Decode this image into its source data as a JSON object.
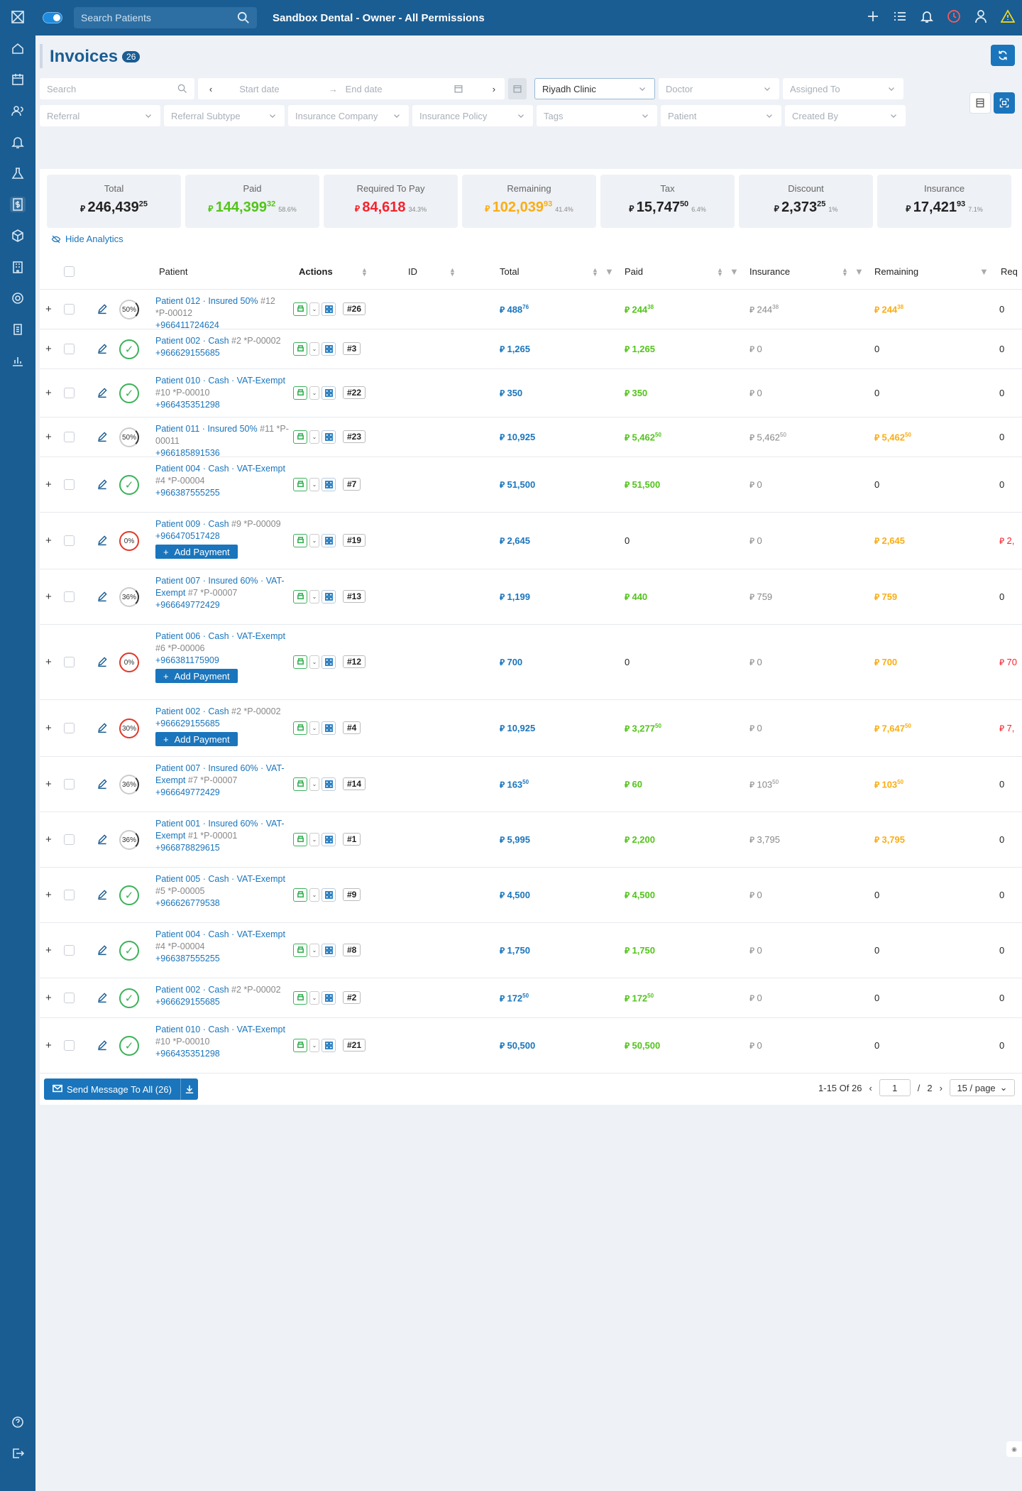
{
  "app": {
    "search_placeholder": "Search Patients",
    "title": "Sandbox Dental - Owner - All Permissions"
  },
  "page": {
    "title": "Invoices",
    "count": "26"
  },
  "filters": {
    "search": "Search",
    "start_date": "Start date",
    "end_date": "End date",
    "clinic": "Riyadh Clinic",
    "doctor": "Doctor",
    "assigned": "Assigned To",
    "referral": "Referral",
    "referral_sub": "Referral Subtype",
    "ins_company": "Insurance Company",
    "ins_policy": "Insurance Policy",
    "tags": "Tags",
    "patient": "Patient",
    "created_by": "Created By"
  },
  "stats": [
    {
      "label": "Total",
      "int": "246,439",
      "dec": "25",
      "pct": "",
      "color": "#222"
    },
    {
      "label": "Paid",
      "int": "144,399",
      "dec": "32",
      "pct": "58.6%",
      "color": "#52c41a"
    },
    {
      "label": "Required To Pay",
      "int": "84,618",
      "dec": "",
      "pct": "34.3%",
      "color": "#f5222d"
    },
    {
      "label": "Remaining",
      "int": "102,039",
      "dec": "93",
      "pct": "41.4%",
      "color": "#faad14"
    },
    {
      "label": "Tax",
      "int": "15,747",
      "dec": "50",
      "pct": "6.4%",
      "color": "#222"
    },
    {
      "label": "Discount",
      "int": "2,373",
      "dec": "25",
      "pct": "1%",
      "color": "#222"
    },
    {
      "label": "Insurance",
      "int": "17,421",
      "dec": "93",
      "pct": "7.1%",
      "color": "#222"
    }
  ],
  "currency": "⃁",
  "hide_analytics": "Hide Analytics",
  "columns": {
    "patient": "Patient",
    "actions": "Actions",
    "id": "ID",
    "total": "Total",
    "paid": "Paid",
    "insurance": "Insurance",
    "remaining": "Remaining",
    "req": "Req"
  },
  "add_payment": "Add Payment",
  "rows": [
    {
      "name": "Patient 012 · Insured 50%",
      "meta": "#12 *P-00012",
      "phone": "+966411724624",
      "pct": "50%",
      "status": "part",
      "id": "#26",
      "total": "488",
      "total_d": "76",
      "paid": "244",
      "paid_d": "38",
      "ins": "244",
      "ins_d": "38",
      "rem": "244",
      "rem_d": "38",
      "req": "0",
      "add": false
    },
    {
      "name": "Patient 002 · Cash",
      "meta": "#2 *P-00002",
      "phone": "+966629155685",
      "pct": "",
      "status": "full",
      "id": "#3",
      "total": "1,265",
      "total_d": "",
      "paid": "1,265",
      "paid_d": "",
      "ins": "0",
      "ins_d": "",
      "rem": "0",
      "rem_d": "",
      "req": "0",
      "add": false
    },
    {
      "name": "Patient 010 · Cash · VAT-Exempt",
      "meta": "#10 *P-00010",
      "phone": "+966435351298",
      "pct": "",
      "status": "full",
      "id": "#22",
      "total": "350",
      "total_d": "",
      "paid": "350",
      "paid_d": "",
      "ins": "0",
      "ins_d": "",
      "rem": "0",
      "rem_d": "",
      "req": "0",
      "add": false
    },
    {
      "name": "Patient 011 · Insured 50%",
      "meta": "#11 *P-00011",
      "phone": "+966185891536",
      "pct": "50%",
      "status": "part",
      "id": "#23",
      "total": "10,925",
      "total_d": "",
      "paid": "5,462",
      "paid_d": "50",
      "ins": "5,462",
      "ins_d": "50",
      "rem": "5,462",
      "rem_d": "50",
      "req": "0",
      "add": false
    },
    {
      "name": "Patient 004 · Cash · VAT-Exempt",
      "meta": "#4 *P-00004",
      "phone": "+966387555255",
      "pct": "",
      "status": "full",
      "id": "#7",
      "total": "51,500",
      "total_d": "",
      "paid": "51,500",
      "paid_d": "",
      "ins": "0",
      "ins_d": "",
      "rem": "0",
      "rem_d": "",
      "req": "0",
      "add": false
    },
    {
      "name": "Patient 009 · Cash",
      "meta": "#9 *P-00009",
      "phone": "+966470517428",
      "pct": "0%",
      "status": "zero",
      "id": "#19",
      "total": "2,645",
      "total_d": "",
      "paid": "0",
      "paid_d": "",
      "ins": "0",
      "ins_d": "",
      "rem": "2,645",
      "rem_d": "",
      "req": "2,",
      "add": true
    },
    {
      "name": "Patient 007 · Insured 60% · VAT-Exempt",
      "meta": "#7 *P-00007",
      "phone": "+966649772429",
      "pct": "36%",
      "status": "part",
      "id": "#13",
      "total": "1,199",
      "total_d": "",
      "paid": "440",
      "paid_d": "",
      "ins": "759",
      "ins_d": "",
      "rem": "759",
      "rem_d": "",
      "req": "0",
      "add": false
    },
    {
      "name": "Patient 006 · Cash · VAT-Exempt",
      "meta": "#6 *P-00006",
      "phone": "+966381175909",
      "pct": "0%",
      "status": "zero",
      "id": "#12",
      "total": "700",
      "total_d": "",
      "paid": "0",
      "paid_d": "",
      "ins": "0",
      "ins_d": "",
      "rem": "700",
      "rem_d": "",
      "req": "70",
      "add": true
    },
    {
      "name": "Patient 002 · Cash",
      "meta": "#2 *P-00002",
      "phone": "+966629155685",
      "pct": "30%",
      "status": "zero",
      "id": "#4",
      "total": "10,925",
      "total_d": "",
      "paid": "3,277",
      "paid_d": "50",
      "ins": "0",
      "ins_d": "",
      "rem": "7,647",
      "rem_d": "50",
      "req": "7,",
      "add": true
    },
    {
      "name": "Patient 007 · Insured 60% · VAT-Exempt",
      "meta": "#7 *P-00007",
      "phone": "+966649772429",
      "pct": "36%",
      "status": "part",
      "id": "#14",
      "total": "163",
      "total_d": "50",
      "paid": "60",
      "paid_d": "",
      "ins": "103",
      "ins_d": "50",
      "rem": "103",
      "rem_d": "50",
      "req": "0",
      "add": false
    },
    {
      "name": "Patient 001 · Insured 60% · VAT-Exempt",
      "meta": "#1 *P-00001",
      "phone": "+966878829615",
      "pct": "36%",
      "status": "part",
      "id": "#1",
      "total": "5,995",
      "total_d": "",
      "paid": "2,200",
      "paid_d": "",
      "ins": "3,795",
      "ins_d": "",
      "rem": "3,795",
      "rem_d": "",
      "req": "0",
      "add": false
    },
    {
      "name": "Patient 005 · Cash · VAT-Exempt",
      "meta": "#5 *P-00005",
      "phone": "+966626779538",
      "pct": "",
      "status": "full",
      "id": "#9",
      "total": "4,500",
      "total_d": "",
      "paid": "4,500",
      "paid_d": "",
      "ins": "0",
      "ins_d": "",
      "rem": "0",
      "rem_d": "",
      "req": "0",
      "add": false
    },
    {
      "name": "Patient 004 · Cash · VAT-Exempt",
      "meta": "#4 *P-00004",
      "phone": "+966387555255",
      "pct": "",
      "status": "full",
      "id": "#8",
      "total": "1,750",
      "total_d": "",
      "paid": "1,750",
      "paid_d": "",
      "ins": "0",
      "ins_d": "",
      "rem": "0",
      "rem_d": "",
      "req": "0",
      "add": false
    },
    {
      "name": "Patient 002 · Cash",
      "meta": "#2 *P-00002",
      "phone": "+966629155685",
      "pct": "",
      "status": "full",
      "id": "#2",
      "total": "172",
      "total_d": "50",
      "paid": "172",
      "paid_d": "50",
      "ins": "0",
      "ins_d": "",
      "rem": "0",
      "rem_d": "",
      "req": "0",
      "add": false
    },
    {
      "name": "Patient 010 · Cash · VAT-Exempt",
      "meta": "#10 *P-00010",
      "phone": "+966435351298",
      "pct": "",
      "status": "full",
      "id": "#21",
      "total": "50,500",
      "total_d": "",
      "paid": "50,500",
      "paid_d": "",
      "ins": "0",
      "ins_d": "",
      "rem": "0",
      "rem_d": "",
      "req": "0",
      "add": false
    }
  ],
  "footer": {
    "send": "Send Message To All (26)",
    "range": "1-15 Of 26",
    "page": "1",
    "of": "/",
    "total_pages": "2",
    "page_size": "15 / page"
  }
}
